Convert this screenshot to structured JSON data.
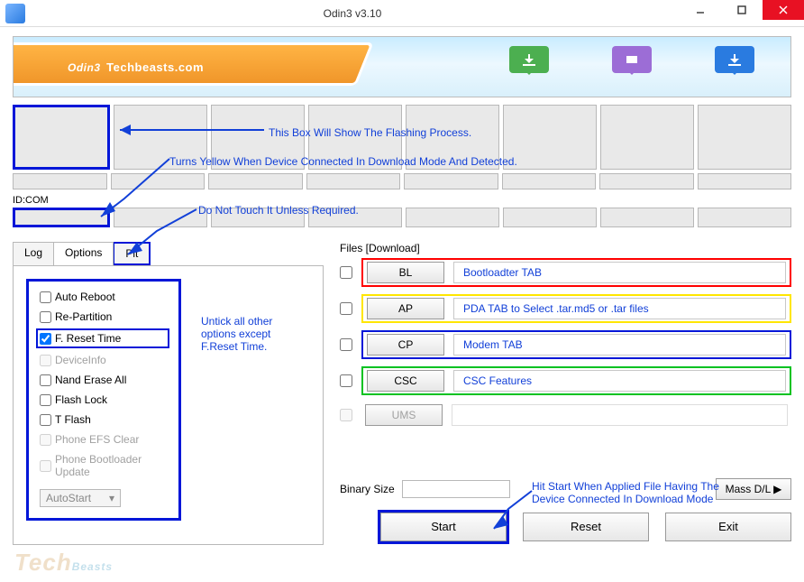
{
  "titlebar": {
    "title": "Odin3 v3.10"
  },
  "banner": {
    "brand": "Odin3",
    "site": "Techbeasts.com"
  },
  "idcom": {
    "label": "ID:COM"
  },
  "tabs": {
    "log": "Log",
    "options": "Options",
    "pit": "Pit"
  },
  "options": {
    "auto_reboot": "Auto Reboot",
    "repartition": "Re-Partition",
    "f_reset_time": "F. Reset Time",
    "device_info": "DeviceInfo",
    "nand_erase_all": "Nand Erase All",
    "flash_lock": "Flash Lock",
    "t_flash": "T Flash",
    "phone_efs_clear": "Phone EFS Clear",
    "phone_bootloader_update": "Phone Bootloader Update",
    "autostart": "AutoStart"
  },
  "files": {
    "section_label": "Files [Download]",
    "bl": {
      "btn": "BL",
      "desc": "Bootloadter TAB"
    },
    "ap": {
      "btn": "AP",
      "desc": "PDA TAB to Select .tar.md5 or .tar files"
    },
    "cp": {
      "btn": "CP",
      "desc": "Modem TAB"
    },
    "csc": {
      "btn": "CSC",
      "desc": "CSC Features"
    },
    "ums": {
      "btn": "UMS",
      "desc": ""
    }
  },
  "binsize": {
    "label": "Binary Size"
  },
  "buttons": {
    "massdl": "Mass D/L ▶",
    "start": "Start",
    "reset": "Reset",
    "exit": "Exit"
  },
  "annotations": {
    "flashing": "This Box Will Show The Flashing Process.",
    "yellow": "Turns Yellow When Device Connected In Download Mode And Detected.",
    "do_not_touch": "Do Not Touch It Unless Required.",
    "untick": "Untick all other options except F.Reset Time.",
    "hit_start": "Hit Start When Applied File Having The Device Connected In Download Mode"
  },
  "watermark": "TechBeasts"
}
